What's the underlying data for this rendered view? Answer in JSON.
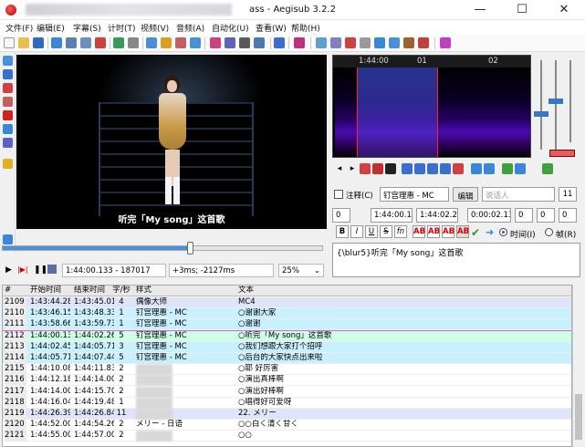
{
  "window": {
    "title": "ass - Aegisub 3.2.2",
    "min_label": "—",
    "max_label": "☐",
    "close_label": "✕"
  },
  "menu": [
    "文件(F)",
    "编辑(E)",
    "字幕(S)",
    "计时(T)",
    "视频(V)",
    "音频(A)",
    "自动化(U)",
    "查看(W)",
    "帮助(H)"
  ],
  "video": {
    "subtitle": "听完「My song」这首歌",
    "time": "1:44:00.133 - 187017",
    "offset": "+3ms; -2127ms",
    "zoom": "25%",
    "position_fraction": 0.585
  },
  "audio": {
    "ticks": [
      "1:44:00",
      "01",
      "02"
    ]
  },
  "editor": {
    "comment_label": "注释(C)",
    "style": "钉宫理惠 - MC",
    "edit_button": "编辑",
    "actor_placeholder": "说话人",
    "margin": "11",
    "layer": "0",
    "start": "1:44:00.13",
    "end": "1:44:02.26",
    "duration": "0:00:02.13",
    "margin_l": "0",
    "margin_r": "0",
    "margin_v": "0",
    "time_label": "时间(I)",
    "frame_label": "帧(R)",
    "format_buttons": [
      "B",
      "I",
      "U",
      "S",
      "fn",
      "AB",
      "AB",
      "AB",
      "AB"
    ],
    "text": "{\\blur5}听完「My song」这首歌"
  },
  "grid": {
    "columns": [
      "#",
      "开始时间",
      "结束时间",
      "字/秒",
      "样式",
      "文本"
    ],
    "rows": [
      {
        "n": "2109",
        "start": "1:43:44.28",
        "end": "1:43:45.01",
        "cps": "4",
        "style": "偶像大师",
        "text": "MC4",
        "state": "comment"
      },
      {
        "n": "2110",
        "start": "1:43:46.15",
        "end": "1:43:48.33",
        "cps": "1",
        "style": "钉宫理惠 - MC",
        "text": "○谢谢大家",
        "state": ""
      },
      {
        "n": "2111",
        "start": "1:43:58.66",
        "end": "1:43:59.73",
        "cps": "1",
        "style": "钉宫理惠 - MC",
        "text": "○谢谢",
        "state": ""
      },
      {
        "n": "2112",
        "start": "1:44:00.13",
        "end": "1:44:02.26",
        "cps": "5",
        "style": "钉宫理惠 - MC",
        "text": "○听完「My song」这首歌",
        "state": "active"
      },
      {
        "n": "2113",
        "start": "1:44:02.45",
        "end": "1:44:05.71",
        "cps": "3",
        "style": "钉宫理惠 - MC",
        "text": "○我们想跟大家打个招呼",
        "state": ""
      },
      {
        "n": "2114",
        "start": "1:44:05.71",
        "end": "1:44:07.44",
        "cps": "5",
        "style": "钉宫理惠 - MC",
        "text": "○后台的大家快点出来啦",
        "state": ""
      },
      {
        "n": "2115",
        "start": "1:44:10.08",
        "end": "1:44:11.83",
        "cps": "2",
        "style": "",
        "text": "○耶 好厉害",
        "state": ""
      },
      {
        "n": "2116",
        "start": "1:44:12.18",
        "end": "1:44:14.00",
        "cps": "2",
        "style": "",
        "text": "○演出真棒啊",
        "state": ""
      },
      {
        "n": "2117",
        "start": "1:44:14.00",
        "end": "1:44:15.70",
        "cps": "2",
        "style": "",
        "text": "○演出好棒啊",
        "state": ""
      },
      {
        "n": "2118",
        "start": "1:44:16.04",
        "end": "1:44:19.48",
        "cps": "1",
        "style": "",
        "text": "○唱得好可爱呀",
        "state": ""
      },
      {
        "n": "2119",
        "start": "1:44:26.39",
        "end": "1:44:26.84",
        "cps": "11",
        "style": "",
        "text": "22. メリー",
        "state": "comment"
      },
      {
        "n": "2120",
        "start": "1:44:52.00",
        "end": "1:44:54.26",
        "cps": "2",
        "style": "メリー - 日语",
        "text": "○○白く清く甘く",
        "state": ""
      },
      {
        "n": "2121",
        "start": "1:44:55.00",
        "end": "1:44:57.00",
        "cps": "2",
        "style": "",
        "text": "○○",
        "state": ""
      }
    ]
  },
  "colors": {
    "selection": "#c9f0ff",
    "active": "#ccffe6",
    "comment": "#e0e4f8",
    "accent": "#3478c6"
  }
}
